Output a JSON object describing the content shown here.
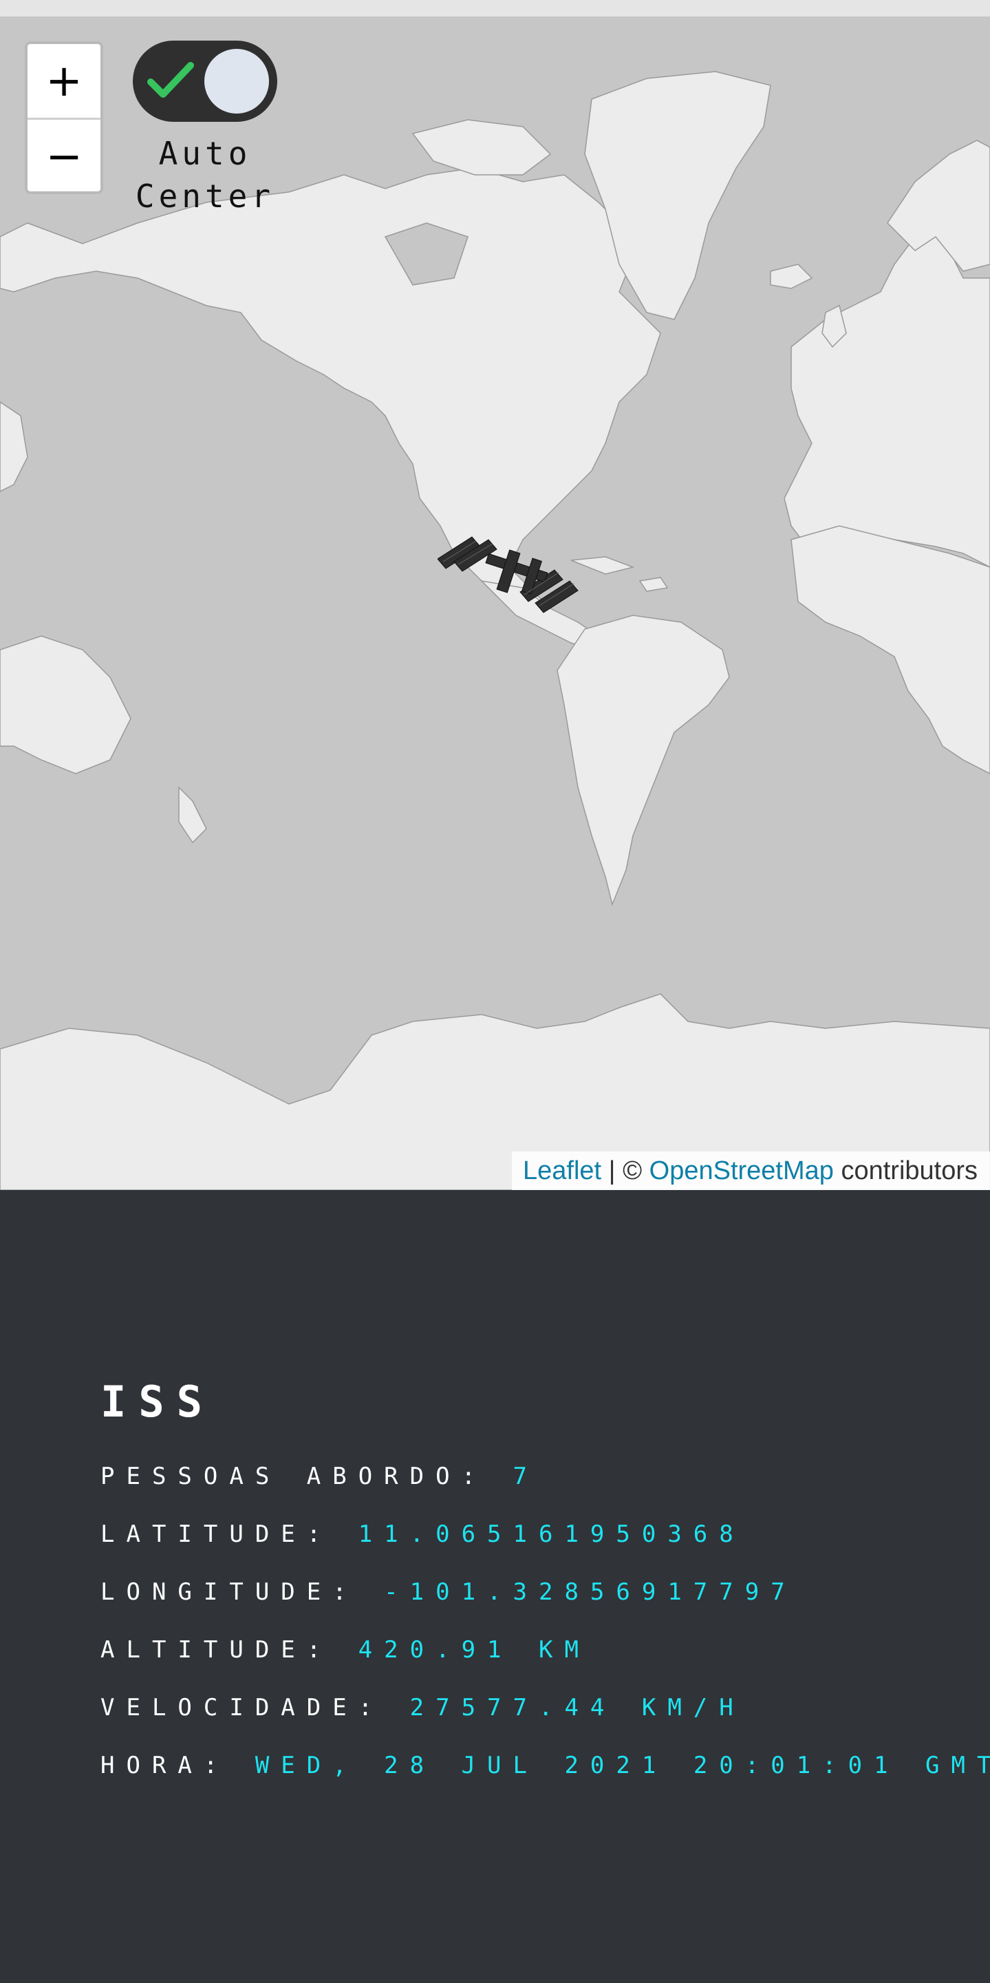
{
  "map": {
    "zoom_in_label": "+",
    "zoom_out_label": "−",
    "auto_center": {
      "line1": "Auto",
      "line2": "Center",
      "enabled": true
    },
    "attribution": {
      "leaflet": "Leaflet",
      "separator": " | © ",
      "osm": "OpenStreetMap",
      "contributors": " contributors"
    },
    "marker_icon": "iss-station-icon",
    "colors": {
      "water": "#c6c6c6",
      "land": "#ececec",
      "toggle_bg": "#2f2f2f",
      "check": "#37c45f"
    }
  },
  "info": {
    "title": "ISS",
    "people_label": "PESSOAS ABORDO: ",
    "people_value": "7",
    "latitude_label": "LATITUDE: ",
    "latitude_value": "11.065161950368",
    "longitude_label": "LONGITUDE: ",
    "longitude_value": "-101.32856917797",
    "altitude_label": "ALTITUDE: ",
    "altitude_value": "420.91 KM",
    "velocity_label": "VELOCIDADE: ",
    "velocity_value": "27577.44 KM/H",
    "time_label": "HORA: ",
    "time_value": "WED, 28 JUL 2021 20:01:01 GMT",
    "colors": {
      "background": "#303338",
      "label": "#ffffff",
      "value": "#1ee3f0"
    }
  }
}
